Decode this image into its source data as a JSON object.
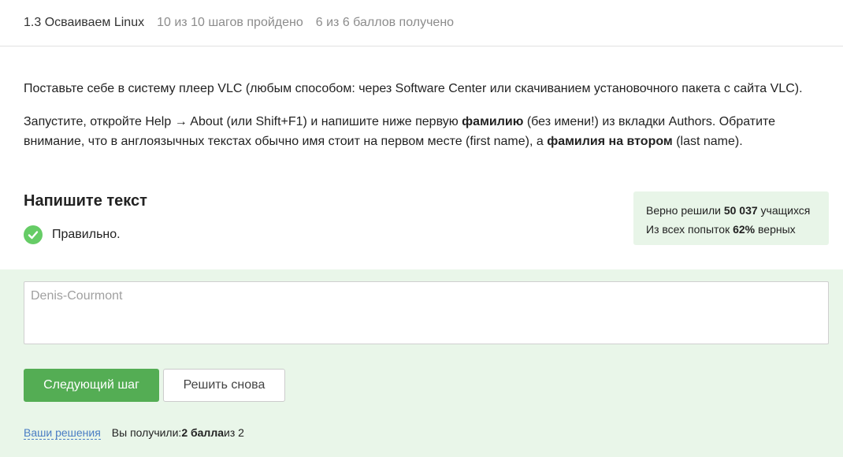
{
  "header": {
    "lesson": "1.3 Осваиваем Linux",
    "steps": "10 из 10 шагов пройдено",
    "points": "6 из 6 баллов  получено"
  },
  "task": {
    "para1": "Поставьте себе в систему плеер VLC (любым способом: через Software Center или скачиванием установочного пакета с сайта VLC).",
    "para2_a": "Запустите, откройте Help → About (или Shift+F1) и напишите ниже первую ",
    "para2_b": "фамилию",
    "para2_c": " (без имени!) из вкладки Authors. Обратите внимание, что в англоязычных текстах обычно имя стоит на первом месте (first name), а ",
    "para2_d": "фамилия на втором",
    "para2_e": " (last name).",
    "title": "Напишите текст",
    "status": "Правильно."
  },
  "stats": {
    "line1_a": "Верно решили ",
    "line1_b": "50 037",
    "line1_c": " учащихся",
    "line2_a": "Из всех попыток ",
    "line2_b": "62%",
    "line2_c": " верных"
  },
  "answer": {
    "value": "Denis-Courmont"
  },
  "buttons": {
    "next": "Следующий шаг",
    "retry": "Решить снова"
  },
  "footer": {
    "link": "Ваши решения",
    "got_a": "Вы получили: ",
    "got_b": "2 балла",
    "got_c": " из 2"
  },
  "colors": {
    "accent_green": "#54ad54",
    "panel_green": "#e9f6e9",
    "link_blue": "#4a7dc4"
  }
}
